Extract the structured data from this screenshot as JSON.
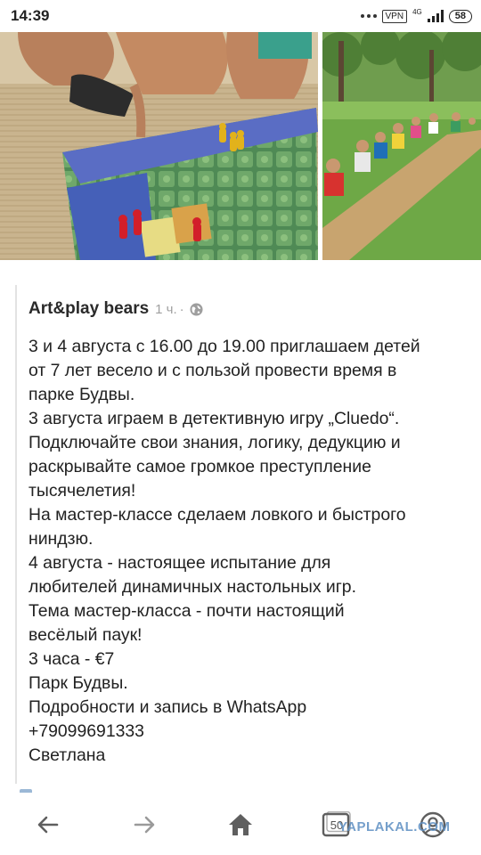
{
  "status_bar": {
    "time": "14:39",
    "vpn": "VPN",
    "network": "4G",
    "battery": "58"
  },
  "images": {
    "left": "board-game-photo",
    "right": "kids-in-park-photo"
  },
  "post": {
    "author": "Art&play bears",
    "time": "1 ч.",
    "separator": "·",
    "visibility_icon": "globe-icon",
    "lines": [
      "3 и 4 августа с 16.00 до 19.00 приглашаем детей",
      "от 7 лет весело и с пользой провести время в",
      "парке Будвы.",
      "3 августа играем в детективную игру „Cluedo“.",
      "Подключайте свои знания, логику, дедукцию и",
      "раскрывайте самое громкое преступление",
      "тысячелетия!",
      "На мастер-классе сделаем ловкого и быстрого",
      "ниндзю.",
      "4 августа - настоящее испытание для",
      "любителей динамичных настольных игр.",
      "Тема мастер-класса - почти настоящий",
      "весёлый паук!",
      "3 часа - €7",
      "Парк Будвы.",
      "Подробности и запись в WhatsApp",
      "+79099691333",
      "Светлана"
    ]
  },
  "bottom_nav": {
    "back": "arrow-left-icon",
    "forward": "arrow-right-icon",
    "home": "home-icon",
    "tabs_count": "50",
    "profile": "profile-icon",
    "watermark": "YAPLAKAL.COM"
  },
  "colors": {
    "text": "#222222",
    "muted": "#a0a0a0",
    "watermark": "#5d8fc2"
  }
}
